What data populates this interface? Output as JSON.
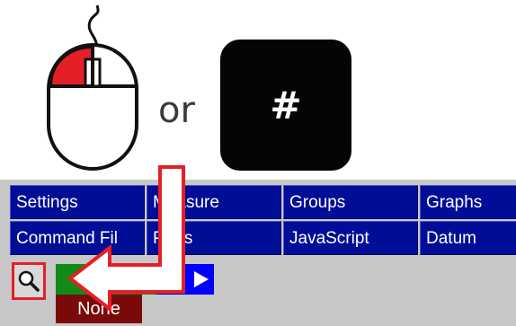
{
  "illustration": {
    "or_label": "or",
    "hash_key_label": "#",
    "mouse_button_highlight_color": "#e51f27"
  },
  "menu": {
    "items": [
      {
        "label": "Settings"
      },
      {
        "label": "Measure"
      },
      {
        "label": "Groups"
      },
      {
        "label": "Graphs"
      },
      {
        "label": "Command Fil"
      },
      {
        "label": "Parts"
      },
      {
        "label": "JavaScript"
      },
      {
        "label": "Datum"
      }
    ],
    "button_color": "#000d96"
  },
  "controls": {
    "search_icon": "magnifier-icon",
    "selection_label": "None",
    "next_icon": "play-arrow-icon"
  },
  "annotation": {
    "arrow_color": "#e51f27",
    "outline_color": "#ffffff"
  }
}
